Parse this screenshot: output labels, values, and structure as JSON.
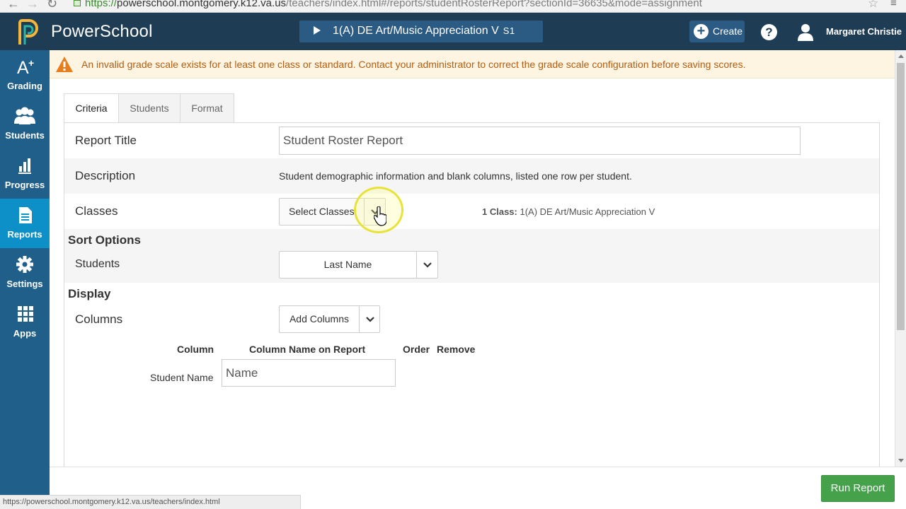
{
  "browser": {
    "url_scheme": "https://",
    "url_host": "powerschool.montgomery.k12.va.us",
    "url_path": "/teachers/index.html#/reports/studentRosterReport?sectionId=36635&mode=assignment"
  },
  "header": {
    "app_name": "PowerSchool",
    "class_name": "1(A) DE Art/Music Appreciation V",
    "term": "S1",
    "create_label": "Create",
    "help_symbol": "?",
    "user_name": "Margaret Christie"
  },
  "sidebar": {
    "items": [
      {
        "label": "Grading",
        "icon": "grading-icon"
      },
      {
        "label": "Students",
        "icon": "students-icon"
      },
      {
        "label": "Progress",
        "icon": "progress-icon"
      },
      {
        "label": "Reports",
        "icon": "reports-icon",
        "active": true
      },
      {
        "label": "Settings",
        "icon": "gear-icon"
      },
      {
        "label": "Apps",
        "icon": "apps-grid-icon"
      }
    ]
  },
  "alert": {
    "message": "An invalid grade scale exists for at least one class or standard. Contact your administrator to correct the grade scale configuration before saving scores."
  },
  "tabs": [
    {
      "label": "Criteria",
      "active": true
    },
    {
      "label": "Students"
    },
    {
      "label": "Format"
    }
  ],
  "form": {
    "report_title": {
      "label": "Report Title",
      "value": "Student Roster Report"
    },
    "description": {
      "label": "Description",
      "value": "Student demographic information and blank columns, listed one row per student."
    },
    "classes": {
      "label": "Classes",
      "button": "Select Classes",
      "summary_count": "1 Class:",
      "summary_value": "1(A) DE Art/Music Appreciation V"
    },
    "sort_options": {
      "heading": "Sort Options",
      "students_label": "Students",
      "students_value": "Last Name"
    },
    "display": {
      "heading": "Display",
      "columns_label": "Columns",
      "add_columns": "Add Columns"
    },
    "columns_table": {
      "headers": [
        "Column",
        "Column Name on Report",
        "Order",
        "Remove"
      ],
      "rows": [
        {
          "column": "Student Name",
          "name_on_report": "Name"
        }
      ]
    }
  },
  "footer": {
    "run_report": "Run Report",
    "status_url": "https://powerschool.montgomery.k12.va.us/teachers/index.html"
  },
  "colors": {
    "header_bg": "#1f3c55",
    "sidebar_bg": "#1f5f89",
    "sidebar_active": "#0d8fc7",
    "alert_bg": "#fdf5e1",
    "alert_text": "#b35c12",
    "run_button": "#45a24b"
  }
}
